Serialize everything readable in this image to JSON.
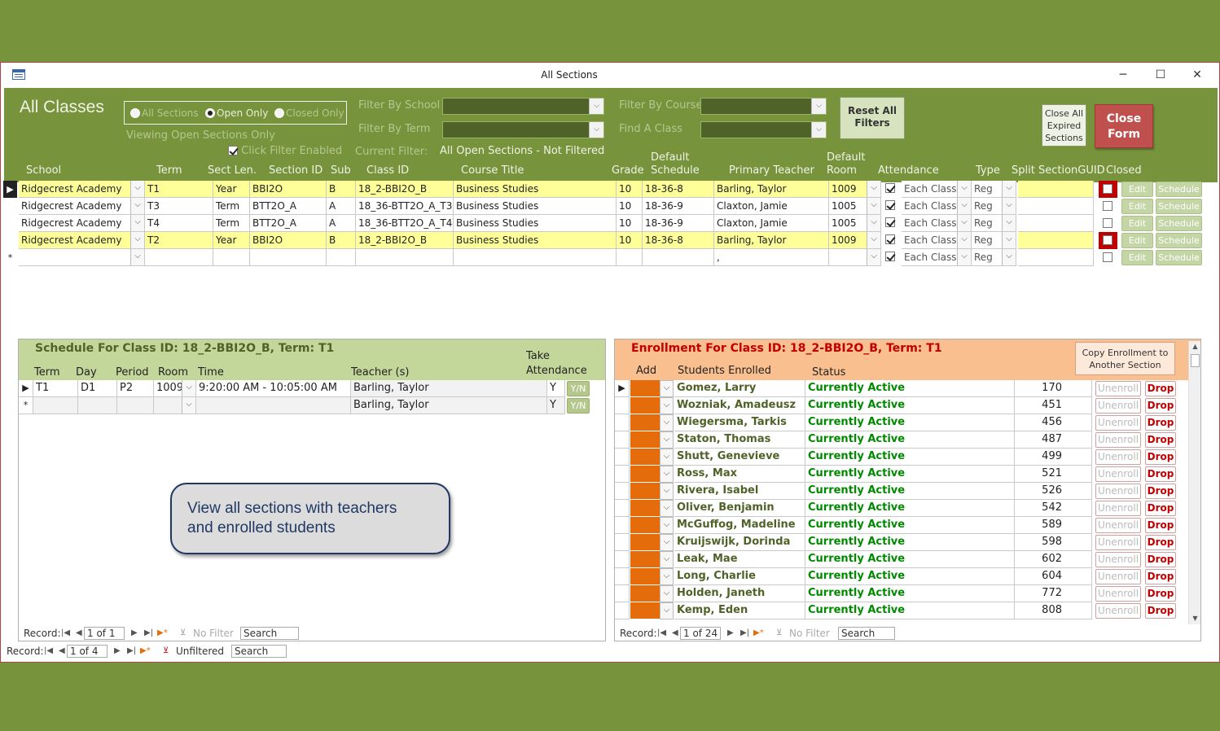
{
  "window": {
    "title": "All Sections",
    "minimize": "─",
    "maximize": "☐",
    "close": "✕"
  },
  "header": {
    "form_title": "All Classes",
    "radio": {
      "all": "All Sections",
      "open": "Open Only",
      "closed": "Closed Only",
      "selected": "open"
    },
    "viewing_status": "Viewing Open Sections Only",
    "click_filter_label": "Click Filter Enabled",
    "filter_school_label": "Filter By School",
    "filter_term_label": "Filter By Term",
    "filter_course_label": "Filter By Course",
    "find_class_label": "Find A Class",
    "current_filter_label": "Current Filter:",
    "current_filter_value": "All Open Sections - Not Filtered",
    "reset_filters_line1": "Reset All",
    "reset_filters_line2": "Filters",
    "close_expired_line1": "Close All",
    "close_expired_line2": "Expired",
    "close_expired_line3": "Sections",
    "close_form_line1": "Close",
    "close_form_line2": "Form"
  },
  "sections_grid": {
    "columns": {
      "school": "School",
      "term": "Term",
      "sect_len": "Sect Len.",
      "section_id": "Section ID",
      "sub": "Sub",
      "class_id": "Class ID",
      "course_title": "Course Title",
      "grade": "Grade",
      "default_schedule_1": "Default",
      "default_schedule_2": "Schedule",
      "primary_teacher": "Primary Teacher",
      "default_room_1": "Default",
      "default_room_2": "Room",
      "attendance": "Attendance",
      "type": "Type",
      "split_guid": "Split SectionGUID",
      "closed": "Closed"
    },
    "rows": [
      {
        "school": "Ridgecrest Academy",
        "term": "T1",
        "sect_len": "Year",
        "section_id": "BBI2O",
        "sub": "B",
        "class_id": "18_2-BBI2O_B",
        "course_title": "Business Studies",
        "grade": "10",
        "schedule": "18-36-8",
        "teacher": "Barling, Taylor",
        "room": "1009",
        "attendance": "Each Class",
        "type": "Reg",
        "highlight": true,
        "closed_red": true
      },
      {
        "school": "Ridgecrest Academy",
        "term": "T3",
        "sect_len": "Term",
        "section_id": "BTT2O_A",
        "sub": "A",
        "class_id": "18_36-BTT2O_A_T3",
        "course_title": "Business Studies",
        "grade": "10",
        "schedule": "18-36-9",
        "teacher": "Claxton, Jamie",
        "room": "1005",
        "attendance": "Each Class",
        "type": "Reg",
        "highlight": false,
        "closed_red": false
      },
      {
        "school": "Ridgecrest Academy",
        "term": "T4",
        "sect_len": "Term",
        "section_id": "BTT2O_A",
        "sub": "A",
        "class_id": "18_36-BTT2O_A_T4",
        "course_title": "Business Studies",
        "grade": "10",
        "schedule": "18-36-9",
        "teacher": "Claxton, Jamie",
        "room": "1005",
        "attendance": "Each Class",
        "type": "Reg",
        "highlight": false,
        "closed_red": false
      },
      {
        "school": "Ridgecrest Academy",
        "term": "T2",
        "sect_len": "Year",
        "section_id": "BBI2O",
        "sub": "B",
        "class_id": "18_2-BBI2O_B",
        "course_title": "Business Studies",
        "grade": "10",
        "schedule": "18-36-8",
        "teacher": "Barling, Taylor",
        "room": "1009",
        "attendance": "Each Class",
        "type": "Reg",
        "highlight": true,
        "closed_red": true
      }
    ],
    "new_row": {
      "teacher": ",",
      "attendance": "Each Class",
      "type": "Reg"
    },
    "edit_label": "Edit",
    "schedule_label": "Schedule",
    "new_record_marker": "*",
    "nav": {
      "label": "Record:",
      "position": "1 of 4",
      "filter": "Unfiltered",
      "search": "Search"
    }
  },
  "schedule": {
    "title": "Schedule For Class ID: 18_2-BBI2O_B, Term: T1",
    "columns": {
      "term": "Term",
      "day": "Day",
      "period": "Period",
      "room": "Room",
      "time": "Time",
      "teacher": "Teacher (s)",
      "take_att_1": "Take",
      "take_att_2": "Attendance"
    },
    "rows": [
      {
        "term": "T1",
        "day": "D1",
        "period": "P2",
        "room": "1009",
        "time": "9:20:00 AM - 10:05:00 AM",
        "teacher": "Barling, Taylor",
        "take": "Y"
      }
    ],
    "new_row": {
      "teacher": "Barling, Taylor",
      "take": "Y"
    },
    "yn_label": "Y/N",
    "new_record_marker": "*",
    "nav": {
      "label": "Record:",
      "position": "1 of 1",
      "filter": "No Filter",
      "search": "Search"
    }
  },
  "callout": {
    "line1": "View all sections with teachers",
    "line2": "and enrolled students"
  },
  "enrollment": {
    "title": "Enrollment For Class ID: 18_2-BBI2O_B, Term: T1",
    "copy_btn_1": "Copy Enrollment to",
    "copy_btn_2": "Another Section",
    "columns": {
      "add": "Add",
      "students": "Students Enrolled",
      "status": "Status"
    },
    "rows": [
      {
        "name": "Gomez, Larry",
        "status": "Currently Active",
        "id": "170"
      },
      {
        "name": "Wozniak, Amadeusz",
        "status": "Currently Active",
        "id": "451"
      },
      {
        "name": "Wiegersma, Tarkis",
        "status": "Currently Active",
        "id": "456"
      },
      {
        "name": "Staton, Thomas",
        "status": "Currently Active",
        "id": "487"
      },
      {
        "name": "Shutt, Genevieve",
        "status": "Currently Active",
        "id": "499"
      },
      {
        "name": "Ross, Max",
        "status": "Currently Active",
        "id": "521"
      },
      {
        "name": "Rivera, Isabel",
        "status": "Currently Active",
        "id": "526"
      },
      {
        "name": "Oliver, Benjamin",
        "status": "Currently Active",
        "id": "542"
      },
      {
        "name": "McGuffog, Madeline",
        "status": "Currently Active",
        "id": "589"
      },
      {
        "name": "Kruijswijk, Dorinda",
        "status": "Currently Active",
        "id": "598"
      },
      {
        "name": "Leak, Mae",
        "status": "Currently Active",
        "id": "602"
      },
      {
        "name": "Long, Charlie",
        "status": "Currently Active",
        "id": "604"
      },
      {
        "name": "Holden, Janeth",
        "status": "Currently Active",
        "id": "772"
      },
      {
        "name": "Kemp, Eden",
        "status": "Currently Active",
        "id": "808"
      }
    ],
    "unenroll_label": "Unenroll",
    "drop_label": "Drop",
    "nav": {
      "label": "Record:",
      "position": "1 of 24",
      "filter": "No Filter",
      "search": "Search"
    }
  },
  "colors": {
    "background": "#77933c",
    "header_green": "#77933c",
    "highlight_row": "#ffff99",
    "close_form_red": "#c0504d",
    "schedule_header": "#c4d79b",
    "enroll_header": "#fabf8f",
    "add_orange": "#e46c0a"
  }
}
